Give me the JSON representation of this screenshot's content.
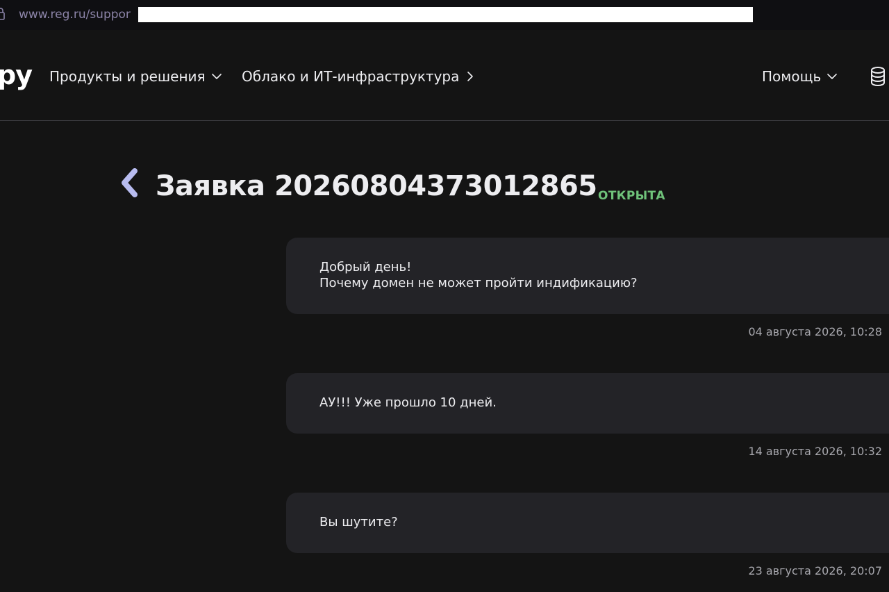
{
  "browser": {
    "url": "www.reg.ru/suppor"
  },
  "header": {
    "logo_fragment": "ру",
    "nav": {
      "products": "Продукты и решения",
      "cloud": "Облако и ИТ-инфраструктура",
      "help": "Помощь"
    },
    "icons": {
      "products_chevron": "chevron-down-icon",
      "cloud_chevron": "chevron-right-icon",
      "help_chevron": "chevron-down-icon",
      "balance": "database-icon"
    }
  },
  "ticket": {
    "title": "Заявка 20260804373012865",
    "status": "ОТКРЫТА",
    "status_color": "#6fc27a",
    "back_icon": "chevron-left-icon"
  },
  "messages": [
    {
      "lines": [
        "Добрый день!",
        "Почему домен не может пройти индификацию?"
      ],
      "time": "04 августа 2026, 10:28"
    },
    {
      "lines": [
        "АУ!!! Уже прошло 10 дней."
      ],
      "time": "14 августа 2026, 10:32"
    },
    {
      "lines": [
        "Вы шутите?"
      ],
      "time": "23 августа 2026, 20:07"
    }
  ],
  "colors": {
    "background": "#141414",
    "bubble": "#232327",
    "accent": "#b8bcf0"
  }
}
